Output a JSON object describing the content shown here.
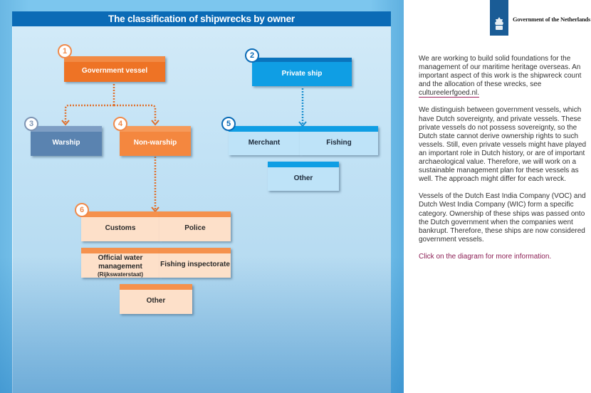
{
  "diagram": {
    "title": "The classification of shipwrecks by owner",
    "nodes": {
      "government_vessel": {
        "number": "1",
        "label": "Government vessel"
      },
      "private_ship": {
        "number": "2",
        "label": "Private ship"
      },
      "warship": {
        "number": "3",
        "label": "Warship"
      },
      "non_warship": {
        "number": "4",
        "label": "Non-warship"
      },
      "private_group": {
        "number": "5",
        "items": [
          "Merchant",
          "Fishing",
          "Other"
        ]
      },
      "non_warship_group": {
        "number": "6",
        "items": [
          "Customs",
          "Police",
          "Official water management",
          "Fishing inspectorate",
          "Other"
        ],
        "sub_label": "(Rijkswaterstaat)"
      }
    },
    "colors": {
      "government": "#ee7325",
      "warship": "#5a83b0",
      "private": "#0f9ee4",
      "title_bar": "#0b6bb6"
    }
  },
  "sidebar": {
    "logo_text": "Government of the Netherlands",
    "paragraph_1": "We are working to build solid foundations for the management of our maritime heritage overseas. An important aspect of this work is the shipwreck count and the allocation of these wrecks, see ",
    "link_text": "cultureelerfgoed.nl.",
    "paragraph_2": "We distinguish between government vessels, which have Dutch sovereignty, and private vessels. These private vessels do not possess sovereignty, so the Dutch state cannot derive ownership rights to such vessels. Still, even private vessels might have played an important role in Dutch history, or are of important archaeological value. Therefore, we will work on a sustainable management plan for these vessels as well. The approach might differ for each wreck.",
    "paragraph_3": "Vessels of the Dutch East India Company (VOC) and Dutch West India Company (WIC) form a specific category. Ownership of these ships was passed onto the Dutch government when the companies went bankrupt. Therefore, these ships are now considered government vessels.",
    "call_to_action": "Click on the diagram for more information."
  }
}
